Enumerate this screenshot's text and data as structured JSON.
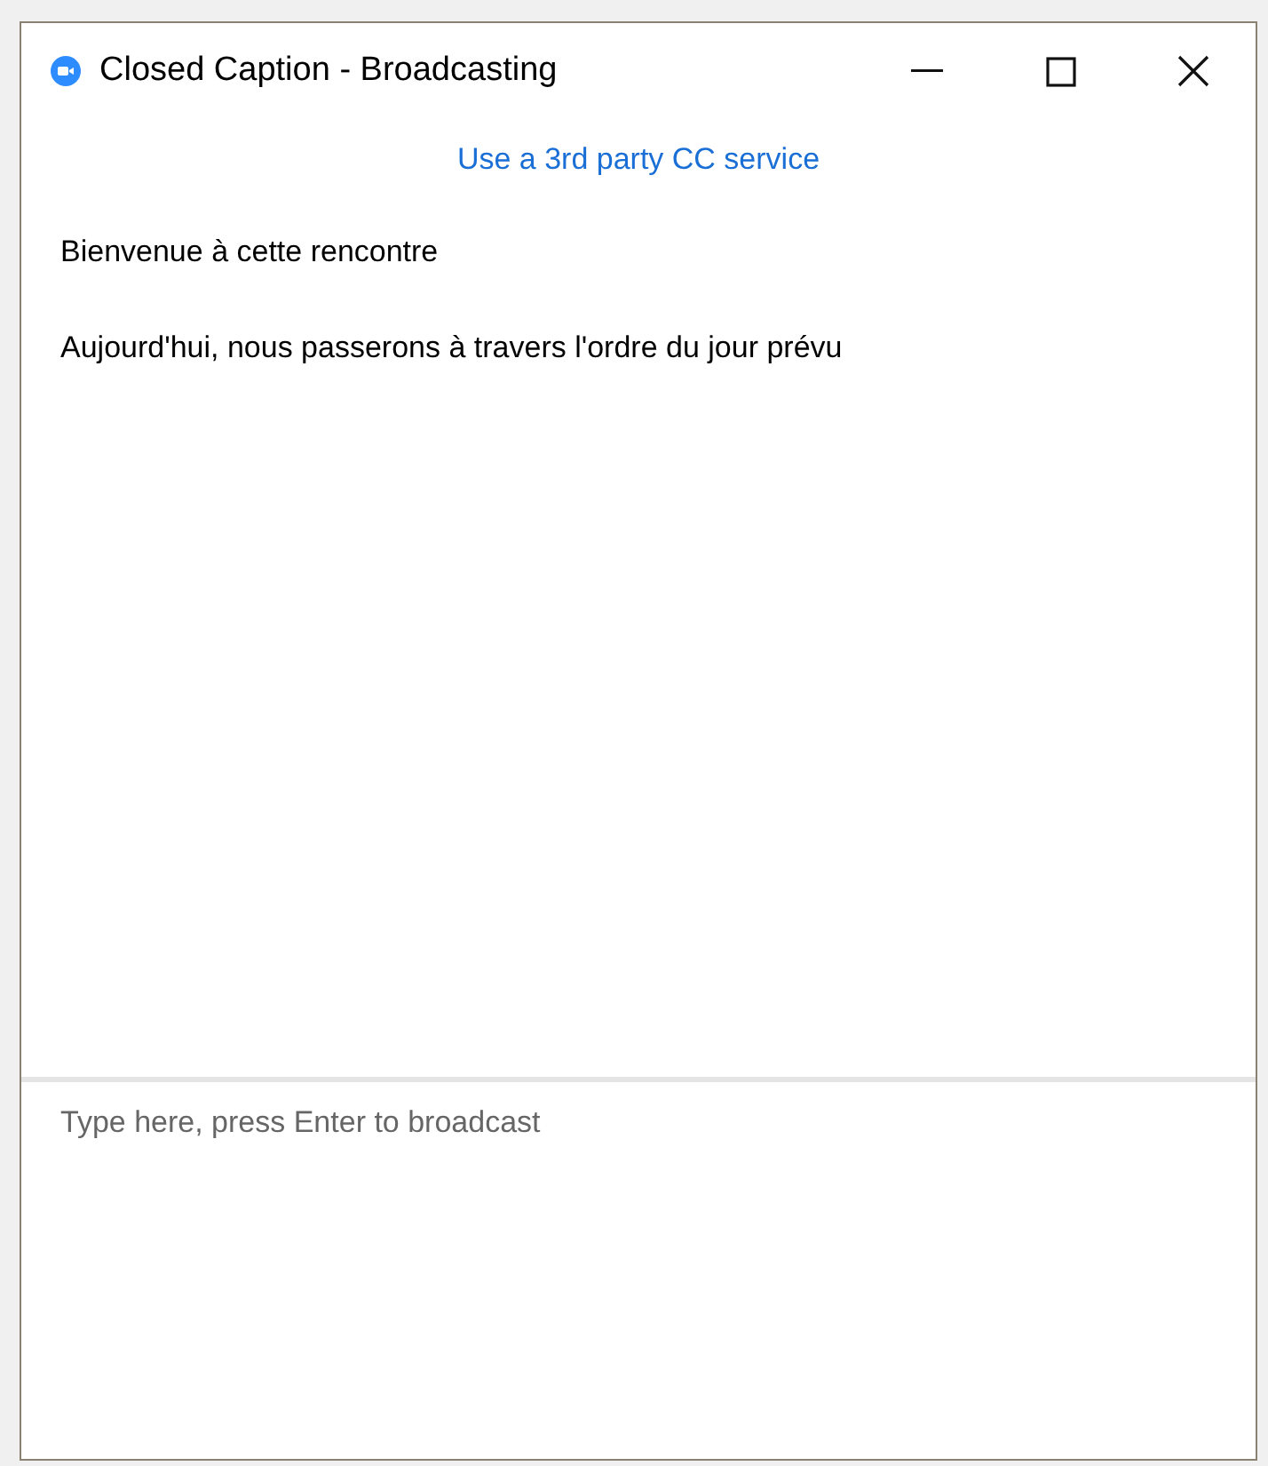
{
  "window": {
    "title": "Closed Caption - Broadcasting"
  },
  "link": "Use a 3rd party CC service",
  "captions": [
    "Bienvenue à cette rencontre",
    "Aujourd'hui, nous passerons à travers l'ordre du jour prévu"
  ],
  "input": {
    "placeholder": "Type here, press Enter to broadcast"
  }
}
